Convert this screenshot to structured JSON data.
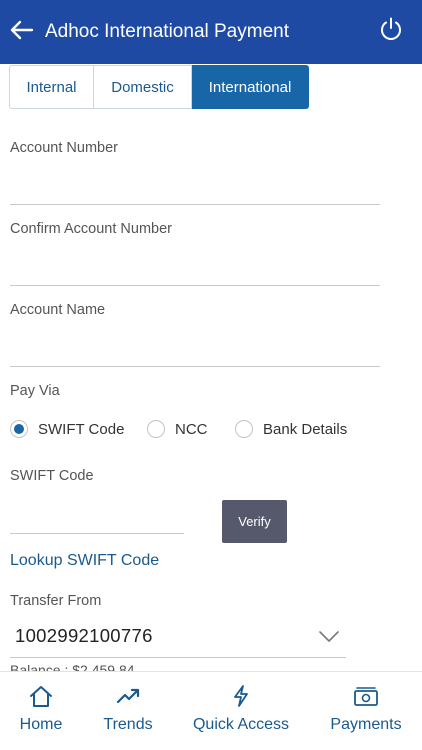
{
  "header": {
    "title": "Adhoc International Payment",
    "back_icon": "arrow-left-icon",
    "power_icon": "power-icon",
    "bg_color": "#1f4aa3"
  },
  "tabs": [
    {
      "label": "Internal",
      "active": false
    },
    {
      "label": "Domestic",
      "active": false
    },
    {
      "label": "International",
      "active": true
    }
  ],
  "form": {
    "account_number": {
      "label": "Account Number",
      "value": ""
    },
    "confirm_account_number": {
      "label": "Confirm Account Number",
      "value": ""
    },
    "account_name": {
      "label": "Account Name",
      "value": ""
    },
    "pay_via": {
      "label": "Pay Via",
      "options": [
        "SWIFT Code",
        "NCC",
        "Bank Details"
      ],
      "selected": "SWIFT Code"
    },
    "swift_code": {
      "label": "SWIFT Code",
      "value": ""
    },
    "verify_label": "Verify",
    "lookup_label": "Lookup SWIFT Code",
    "transfer_from": {
      "label": "Transfer From",
      "value": "1002992100776",
      "balance": "Balance : $2,459.84"
    }
  },
  "bottom_nav": [
    {
      "label": "Home",
      "icon": "home-icon"
    },
    {
      "label": "Trends",
      "icon": "trends-icon"
    },
    {
      "label": "Quick Access",
      "icon": "lightning-icon"
    },
    {
      "label": "Payments",
      "icon": "payments-icon"
    }
  ],
  "colors": {
    "accent": "#1866a7",
    "link": "#1b5a8c",
    "verify_button": "#55596b"
  }
}
